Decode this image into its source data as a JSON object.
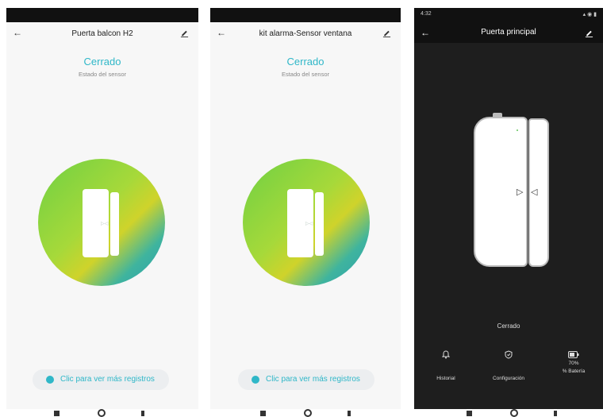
{
  "screens": [
    {
      "title": "Puerta balcon H2",
      "status": "Cerrado",
      "status_sub": "Estado del sensor",
      "records_link": "Clic para ver más registros"
    },
    {
      "title": "kit alarma-Sensor ventana",
      "status": "Cerrado",
      "status_sub": "Estado del sensor",
      "records_link": "Clic para ver más registros"
    },
    {
      "status_bar_time": "4:32",
      "title": "Puerta principal",
      "status": "Cerrado",
      "bottom": {
        "history_label": "Historial",
        "config_label": "Configuración",
        "battery_value": "70%",
        "battery_label": "% Batería"
      }
    }
  ],
  "colors": {
    "accent": "#2fb7c8",
    "dark_bg": "#1e1e1e"
  },
  "icons": {
    "back": "arrow-left-icon",
    "edit": "pencil-icon",
    "info": "info-dot-icon",
    "history": "bell-icon",
    "config": "shield-icon",
    "battery": "battery-icon"
  }
}
